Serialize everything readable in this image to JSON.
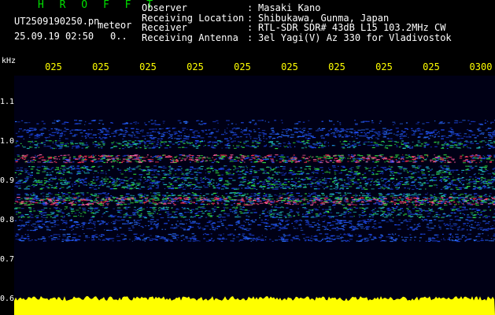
{
  "header": {
    "app_title": "H R O F F T",
    "file_name": "UT2509190250.pn",
    "mode": "meteor",
    "datetime": "25.09.19 02:50",
    "extra": "0..",
    "info": [
      {
        "label": "Observer",
        "value": "Masaki Kano"
      },
      {
        "label": "Receiving Location",
        "value": "Shibukawa, Gunma, Japan"
      },
      {
        "label": "Receiver",
        "value": "RTL-SDR SDR# 43dB L15 103.2MHz CW"
      },
      {
        "label": "Receiving Antenna",
        "value": "3el Yagi(V) Az 330 for Vladivostok"
      }
    ]
  },
  "time_axis": {
    "labels": [
      "025",
      "025",
      "025",
      "025",
      "025",
      "025",
      "025",
      "025",
      "025",
      "0300"
    ]
  },
  "freq_axis": {
    "unit": "kHz",
    "labels": [
      "1.1",
      "1.0",
      "0.9",
      "0.8",
      "0.7",
      "0.6"
    ]
  },
  "colors": {
    "title": "#00e000",
    "time_labels": "#ffff00",
    "background": "#000015",
    "signal_strong": "#ff3050",
    "signal_mid": "#30e040",
    "signal_low": "#2050ff",
    "noise_bar": "#ffff00"
  }
}
